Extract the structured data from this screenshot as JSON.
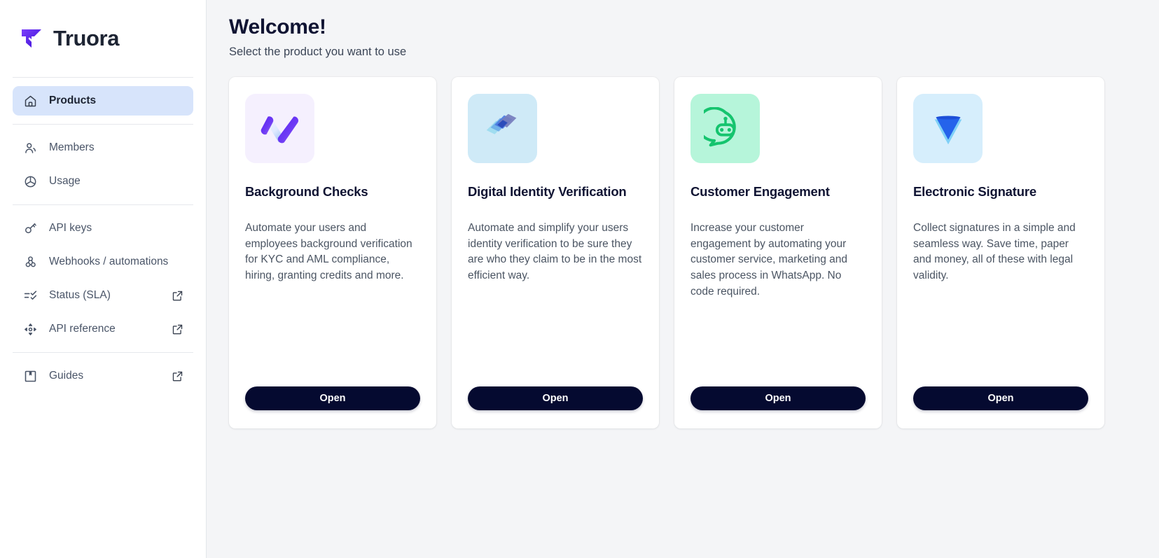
{
  "brand": {
    "name": "Truora",
    "logo_icon": "truora-logo-icon",
    "accent": "#5b21f0"
  },
  "sidebar": {
    "primary": [
      {
        "id": "products",
        "label": "Products",
        "icon": "home-icon",
        "active": true,
        "external": false
      }
    ],
    "group_account": [
      {
        "id": "members",
        "label": "Members",
        "icon": "members-icon",
        "active": false,
        "external": false
      },
      {
        "id": "usage",
        "label": "Usage",
        "icon": "usage-chart-icon",
        "active": false,
        "external": false
      }
    ],
    "group_developer": [
      {
        "id": "api-keys",
        "label": "API keys",
        "icon": "key-icon",
        "active": false,
        "external": false
      },
      {
        "id": "webhooks",
        "label": "Webhooks / automations",
        "icon": "webhook-icon",
        "active": false,
        "external": false
      },
      {
        "id": "status-sla",
        "label": "Status (SLA)",
        "icon": "checklist-icon",
        "active": false,
        "external": true
      },
      {
        "id": "api-reference",
        "label": "API reference",
        "icon": "move-arrows-icon",
        "active": false,
        "external": true
      }
    ],
    "group_docs": [
      {
        "id": "guides",
        "label": "Guides",
        "icon": "book-icon",
        "active": false,
        "external": true
      }
    ],
    "active_item_bg": "#d7e4fb"
  },
  "main": {
    "title": "Welcome!",
    "subtitle": "Select the product you want to use",
    "cards": [
      {
        "id": "background-checks",
        "title": "Background Checks",
        "description": "Automate your users and employees background verification for KYC and AML compliance, hiring, granting credits and more.",
        "button_label": "Open",
        "icon": "background-checks-icon",
        "tile_color": "#f5f0fe",
        "mark_color": "#5b21f0"
      },
      {
        "id": "digital-identity-verification",
        "title": "Digital Identity Verification",
        "description": "Automate and simplify your users identity verification to be sure they are who they claim to be in the most efficient way.",
        "button_label": "Open",
        "icon": "identity-layers-icon",
        "tile_color": "#cfeaf7",
        "mark_color": "#2f4fbf"
      },
      {
        "id": "customer-engagement",
        "title": "Customer Engagement",
        "description": "Increase your customer engagement by automating your customer service, marketing and sales process in WhatsApp. No code required.",
        "button_label": "Open",
        "icon": "chatbot-bubble-icon",
        "tile_color": "#b6f5da",
        "mark_color": "#15c46e"
      },
      {
        "id": "electronic-signature",
        "title": "Electronic Signature",
        "description": "Collect signatures in a simple and seamless way. Save time, paper and money, all of these with legal validity.",
        "button_label": "Open",
        "icon": "signature-triangle-icon",
        "tile_color": "#d6eefc",
        "mark_color": "#2563eb"
      }
    ]
  },
  "theme": {
    "page_bg": "#f4f5f7",
    "surface": "#ffffff",
    "button_bg": "#050a30",
    "button_fg": "#ffffff",
    "heading": "#101433",
    "body_text": "#4b5563"
  }
}
